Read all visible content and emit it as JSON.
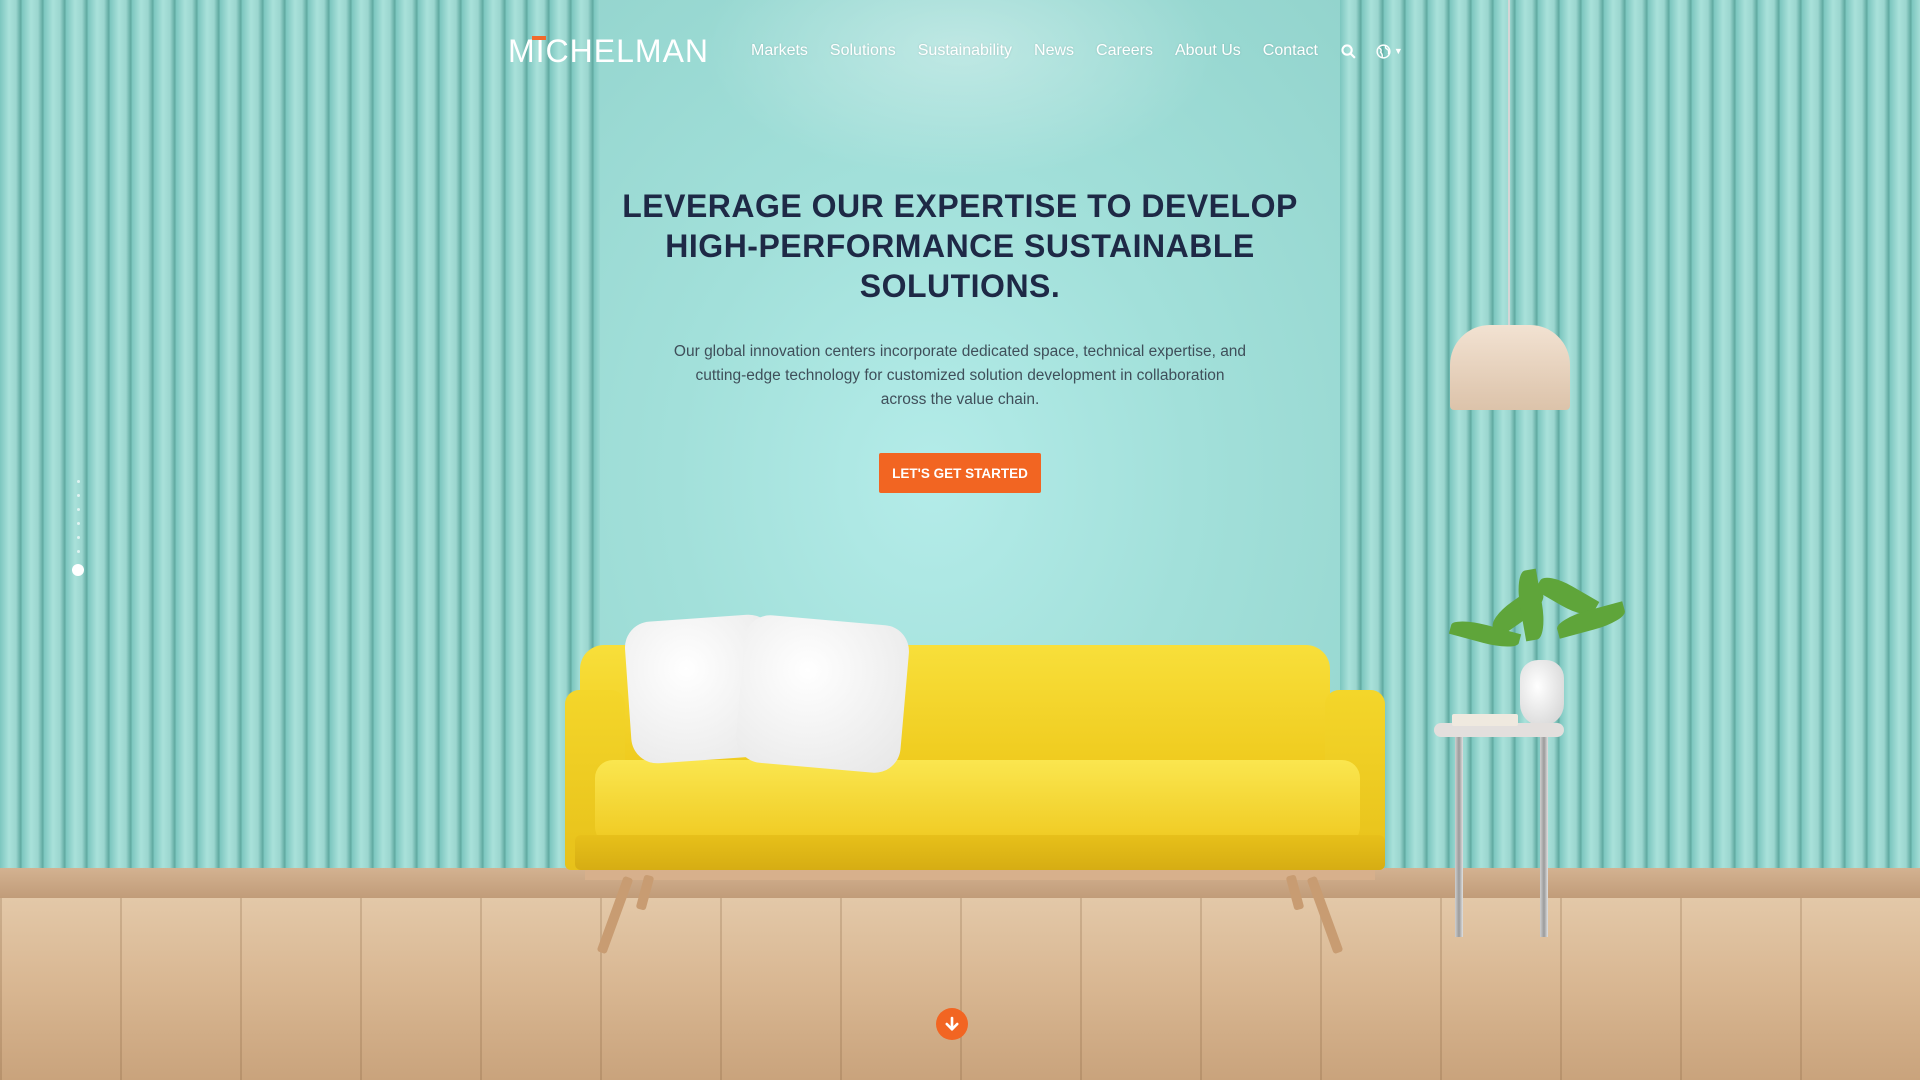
{
  "brand": {
    "logo": "MICHELMAN",
    "accent_color": "#f26522"
  },
  "nav": {
    "items": [
      {
        "label": "Markets"
      },
      {
        "label": "Solutions"
      },
      {
        "label": "Sustainability"
      },
      {
        "label": "News"
      },
      {
        "label": "Careers"
      },
      {
        "label": "About Us"
      },
      {
        "label": "Contact"
      }
    ],
    "search_icon": "search-icon",
    "language_icon": "globe-icon"
  },
  "hero": {
    "title_lines": [
      "LEVERAGE OUR EXPERTISE TO DEVELOP",
      "HIGH-PERFORMANCE SUSTAINABLE",
      "SOLUTIONS."
    ],
    "description_lines": [
      "Our global innovation centers incorporate dedicated space, technical expertise, and",
      "cutting-edge technology for customized solution development in collaboration",
      "across the value chain."
    ],
    "cta_label": "LET'S GET STARTED"
  },
  "scroll_icon": "arrow-down-icon"
}
